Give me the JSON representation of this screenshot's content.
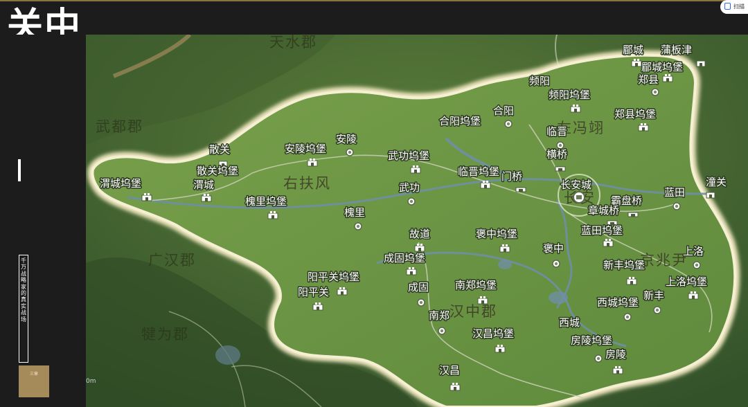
{
  "page": {
    "title": "关中",
    "sidebar_vertical_text": "千万战略家的真实战场",
    "chapter_badge": "三章",
    "scale_label": "0m",
    "scan_widget_label": "扫描"
  },
  "map": {
    "colors": {
      "background": "#1c1c1c",
      "outer_terrain": "#4a6f33",
      "region_fill": "#6f9a45",
      "border_glow": "#efe6bf",
      "river": "#6f8fa4",
      "road": "#c9cfb6",
      "label": "#ffffff"
    },
    "regions": [
      {
        "name": "右扶风",
        "kind": "inside"
      },
      {
        "name": "左冯翊",
        "kind": "inside"
      },
      {
        "name": "京兆尹",
        "kind": "inside"
      },
      {
        "name": "汉中郡",
        "kind": "inside"
      },
      {
        "name": "长安",
        "kind": "inside"
      },
      {
        "name": "武都郡",
        "kind": "outside"
      },
      {
        "name": "广汉郡",
        "kind": "outside"
      },
      {
        "name": "犍为郡",
        "kind": "outside"
      },
      {
        "name": "天水郡",
        "kind": "outside"
      }
    ],
    "places": [
      {
        "name": "郿城",
        "icon": "fort-icon"
      },
      {
        "name": "蒲板津",
        "icon": "gate-icon"
      },
      {
        "name": "郿城坞堡",
        "icon": "fort-icon"
      },
      {
        "name": "郑县",
        "icon": "town-icon"
      },
      {
        "name": "频阳",
        "icon": "none"
      },
      {
        "name": "频阳坞堡",
        "icon": "fort-icon"
      },
      {
        "name": "合阳",
        "icon": "none"
      },
      {
        "name": "郑县坞堡",
        "icon": "fort-icon"
      },
      {
        "name": "合阳坞堡",
        "icon": "town-icon"
      },
      {
        "name": "临晋",
        "icon": "town-icon"
      },
      {
        "name": "安陵",
        "icon": "town-icon"
      },
      {
        "name": "散关",
        "icon": "gate-icon"
      },
      {
        "name": "安陵坞堡",
        "icon": "fort-icon"
      },
      {
        "name": "武功坞堡",
        "icon": "fort-icon"
      },
      {
        "name": "横桥",
        "icon": "bridge-icon"
      },
      {
        "name": "散关坞堡",
        "icon": "none"
      },
      {
        "name": "临晋坞堡",
        "icon": "fort-icon"
      },
      {
        "name": "门桥",
        "icon": "bridge-icon"
      },
      {
        "name": "渭城坞堡",
        "icon": "fort-icon"
      },
      {
        "name": "渭城",
        "icon": "fort-icon"
      },
      {
        "name": "长安城",
        "icon": "capital-icon"
      },
      {
        "name": "蓝田",
        "icon": "town-icon"
      },
      {
        "name": "潼关",
        "icon": "gate-icon"
      },
      {
        "name": "武功",
        "icon": "town-icon"
      },
      {
        "name": "霸盘桥",
        "icon": "bridge-icon"
      },
      {
        "name": "槐里坞堡",
        "icon": "fort-icon"
      },
      {
        "name": "章城桥",
        "icon": "bridge-icon"
      },
      {
        "name": "槐里",
        "icon": "town-icon"
      },
      {
        "name": "蓝田坞堡",
        "icon": "fort-icon"
      },
      {
        "name": "故道",
        "icon": "fort-icon"
      },
      {
        "name": "褒中坞堡",
        "icon": "fort-icon"
      },
      {
        "name": "褒中",
        "icon": "town-icon"
      },
      {
        "name": "上洛",
        "icon": "town-icon"
      },
      {
        "name": "成固坞堡",
        "icon": "fort-icon"
      },
      {
        "name": "新丰坞堡",
        "icon": "fort-icon"
      },
      {
        "name": "阳平关坞堡",
        "icon": "fort-icon"
      },
      {
        "name": "上洛坞堡",
        "icon": "fort-icon"
      },
      {
        "name": "南郑坞堡",
        "icon": "fort-icon"
      },
      {
        "name": "成固",
        "icon": "town-icon"
      },
      {
        "name": "阳平关",
        "icon": "fort-icon"
      },
      {
        "name": "新丰",
        "icon": "town-icon"
      },
      {
        "name": "西城坞堡",
        "icon": "town-icon"
      },
      {
        "name": "南郑",
        "icon": "town-icon"
      },
      {
        "name": "西城",
        "icon": "none"
      },
      {
        "name": "汉昌坞堡",
        "icon": "fort-icon"
      },
      {
        "name": "房陵坞堡",
        "icon": "town-icon"
      },
      {
        "name": "房陵",
        "icon": "fort-icon"
      },
      {
        "name": "汉昌",
        "icon": "fort-icon"
      }
    ]
  }
}
